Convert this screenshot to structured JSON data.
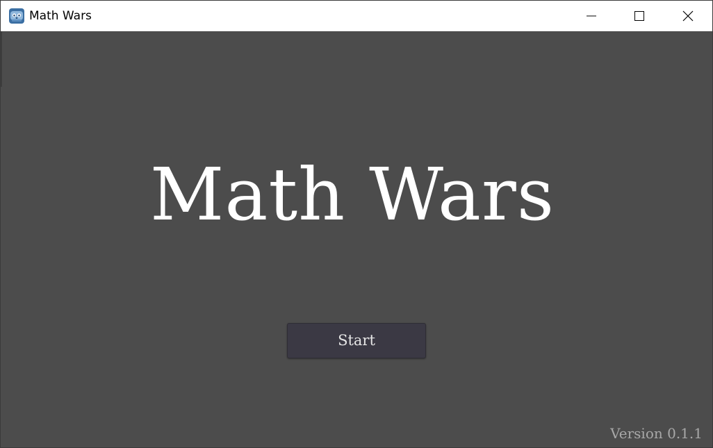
{
  "window": {
    "title": "Math Wars",
    "app_icon": "godot-icon",
    "controls": {
      "minimize": "minimize-icon",
      "maximize": "maximize-icon",
      "close": "close-icon"
    }
  },
  "main": {
    "title": "Math Wars",
    "start_label": "Start",
    "version": "Version 0.1.1"
  },
  "colors": {
    "background": "#4c4c4c",
    "button_bg": "#3b3944",
    "title_text": "#ffffff",
    "version_text": "#a8a8a8"
  }
}
